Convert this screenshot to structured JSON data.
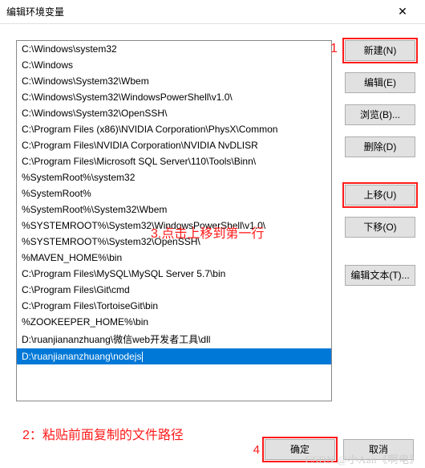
{
  "titlebar": {
    "title": "编辑环境变量",
    "close": "✕"
  },
  "list": {
    "items": [
      "C:\\Windows\\system32",
      "C:\\Windows",
      "C:\\Windows\\System32\\Wbem",
      "C:\\Windows\\System32\\WindowsPowerShell\\v1.0\\",
      "C:\\Windows\\System32\\OpenSSH\\",
      "C:\\Program Files (x86)\\NVIDIA Corporation\\PhysX\\Common",
      "C:\\Program Files\\NVIDIA Corporation\\NVIDIA NvDLISR",
      "C:\\Program Files\\Microsoft SQL Server\\110\\Tools\\Binn\\",
      "%SystemRoot%\\system32",
      "%SystemRoot%",
      "%SystemRoot%\\System32\\Wbem",
      "%SYSTEMROOT%\\System32\\WindowsPowerShell\\v1.0\\",
      "%SYSTEMROOT%\\System32\\OpenSSH\\",
      "%MAVEN_HOME%\\bin",
      "C:\\Program Files\\MySQL\\MySQL Server 5.7\\bin",
      "C:\\Program Files\\Git\\cmd",
      "C:\\Program Files\\TortoiseGit\\bin",
      "%ZOOKEEPER_HOME%\\bin",
      "D:\\ruanjiananzhuang\\微信web开发者工具\\dll",
      "D:\\ruanjiananzhuang\\nodejs"
    ],
    "selected_index": 19
  },
  "buttons": {
    "new": "新建(N)",
    "edit": "编辑(E)",
    "browse": "浏览(B)...",
    "delete": "删除(D)",
    "move_up": "上移(U)",
    "move_down": "下移(O)",
    "edit_text": "编辑文本(T)...",
    "ok": "确定",
    "cancel": "取消"
  },
  "annotations": {
    "a1": "1",
    "a2": "2：粘贴前面复制的文件路径",
    "a3": "3.点击上移到第一行",
    "a4": "4"
  },
  "watermark": "CSDN @小Aan《啊电》"
}
